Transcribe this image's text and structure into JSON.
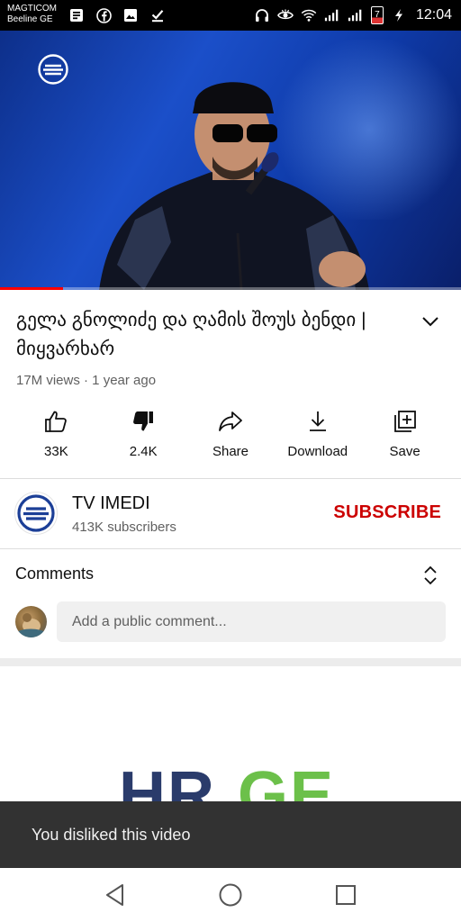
{
  "status_bar": {
    "carrier_line1": "MAGTICOM",
    "carrier_line2": "Beeline GE",
    "battery_level": "7",
    "time": "12:04",
    "left_icons": [
      "notes-icon",
      "facebook-icon",
      "image-icon",
      "download-done-icon"
    ],
    "right_icons": [
      "headphones-icon",
      "eye-icon",
      "wifi-icon",
      "signal-icon",
      "signal-icon",
      "battery-icon",
      "charging-icon"
    ]
  },
  "video": {
    "progress_fraction": 0.137,
    "progress_color": "#ff0000"
  },
  "title": "გელა გნოლიძე და ღამის შოუს ბენდი | მიყვარხარ",
  "meta": "17M views · 1 year ago",
  "actions": {
    "like_label": "33K",
    "dislike_label": "2.4K",
    "share_label": "Share",
    "download_label": "Download",
    "save_label": "Save"
  },
  "channel": {
    "name": "TV IMEDI",
    "subscribers": "413K subscribers",
    "subscribe_label": "SUBSCRIBE",
    "subscribe_color": "#cc0000"
  },
  "comments": {
    "title": "Comments",
    "placeholder": "Add a public comment..."
  },
  "ad": {
    "text_left": "HR",
    "text_right": "GE"
  },
  "snackbar": {
    "message": "You disliked this video"
  }
}
